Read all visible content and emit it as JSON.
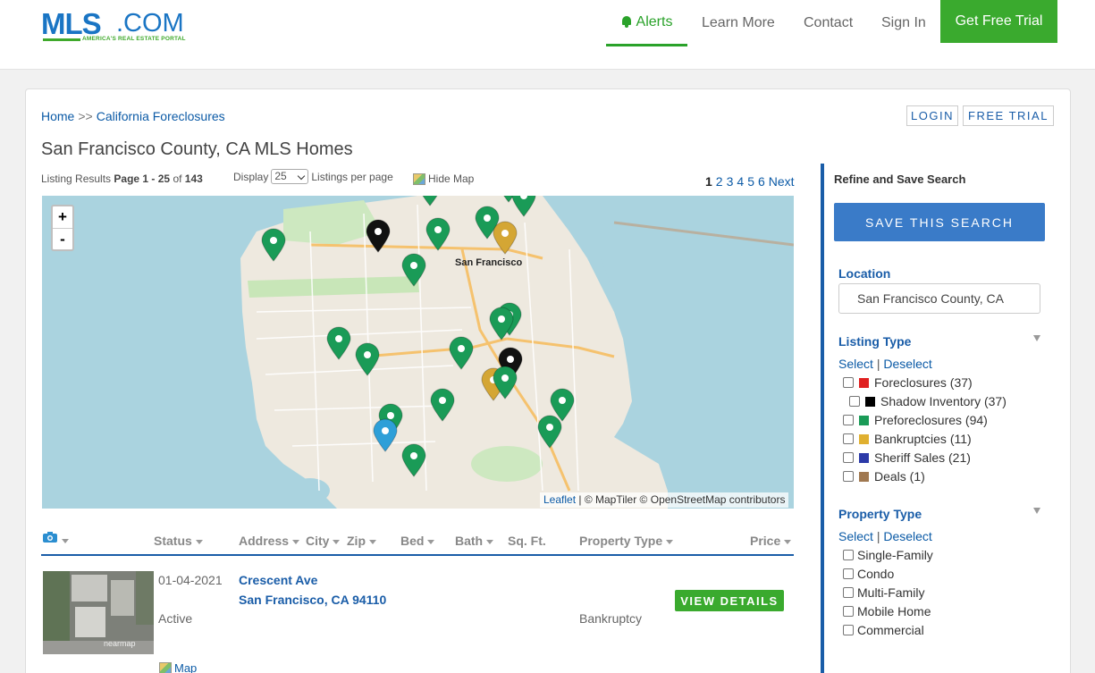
{
  "header": {
    "logo_main": "MLS",
    "logo_dot": ".COM",
    "logo_tagline": "AMERICA'S REAL ESTATE PORTAL",
    "nav": {
      "alerts": "Alerts",
      "learn_more": "Learn More",
      "contact": "Contact",
      "sign_in": "Sign In",
      "free_trial": "Get Free Trial"
    }
  },
  "breadcrumb": {
    "home": "Home",
    "separator": ">>",
    "current": "California Foreclosures"
  },
  "account": {
    "login": "LOGIN",
    "free_trial": "FREE TRIAL"
  },
  "page_title": "San Francisco County, CA MLS Homes",
  "results": {
    "prefix": "Listing Results",
    "page_label": "Page 1 - 25",
    "of": "of",
    "total": "143",
    "display_label": "Display",
    "per_page": "25",
    "per_page_suffix": "Listings per page",
    "hide_map": "Hide Map"
  },
  "pager": {
    "current": "1",
    "pages": [
      "2",
      "3",
      "4",
      "5",
      "6"
    ],
    "next": "Next"
  },
  "map": {
    "city_label": "San Francisco",
    "attribution_leaflet": "Leaflet",
    "attribution_rest": " | © MapTiler © OpenStreetMap contributors",
    "zoom_in": "+",
    "zoom_out": "-",
    "marker_colors": {
      "preforeclosure": "#1a9b57",
      "shadow": "#111111",
      "bankruptcy": "#d4a634",
      "active": "#2e9fd8"
    }
  },
  "table": {
    "columns": {
      "status": "Status",
      "address": "Address",
      "city": "City",
      "zip": "Zip",
      "bed": "Bed",
      "bath": "Bath",
      "sqft": "Sq. Ft.",
      "ptype": "Property Type",
      "price": "Price"
    },
    "rows": [
      {
        "date": "01-04-2021",
        "status": "Active",
        "street": "Crescent Ave",
        "city_line": "San Francisco, CA 94110",
        "property_type": "Bankruptcy",
        "view_label": "VIEW DETAILS",
        "map_label": "Map",
        "thumb_watermark": "nearmap"
      }
    ]
  },
  "sidebar": {
    "title": "Refine and Save Search",
    "save_button": "SAVE THIS SEARCH",
    "location_label": "Location",
    "location_value": "San Francisco County, CA",
    "listing_type_label": "Listing Type",
    "select": "Select",
    "pipe": "|",
    "deselect": "Deselect",
    "listing_types": [
      {
        "label": "Foreclosures (37)",
        "color": "#e02020"
      },
      {
        "label": "Shadow Inventory (37)",
        "color": "#000000"
      },
      {
        "label": "Preforeclosures (94)",
        "color": "#1a9b57"
      },
      {
        "label": "Bankruptcies (11)",
        "color": "#e0b030"
      },
      {
        "label": "Sheriff Sales (21)",
        "color": "#2c3aa8"
      },
      {
        "label": "Deals (1)",
        "color": "#a07850"
      }
    ],
    "property_type_label": "Property Type",
    "property_types": [
      "Single-Family",
      "Condo",
      "Multi-Family",
      "Mobile Home",
      "Commercial"
    ]
  }
}
